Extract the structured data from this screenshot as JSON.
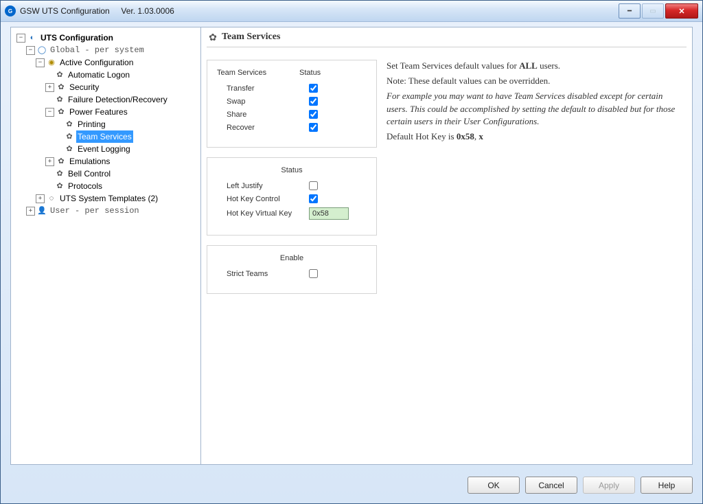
{
  "titlebar": {
    "app": "GSW UTS Configuration",
    "version": "Ver. 1.03.0006"
  },
  "tree": {
    "root": "UTS Configuration",
    "global": "Global  - per system",
    "active": "Active Configuration",
    "autolog": "Automatic Logon",
    "security": "Security",
    "failure": "Failure Detection/Recovery",
    "power": "Power Features",
    "printing": "Printing",
    "team": "Team Services",
    "eventlog": "Event Logging",
    "emulations": "Emulations",
    "bell": "Bell Control",
    "protocols": "Protocols",
    "templates": "UTS System Templates (2)",
    "user": "User   - per session"
  },
  "header": {
    "title": "Team Services"
  },
  "group1": {
    "h1": "Team Services",
    "h2": "Status",
    "transfer": "Transfer",
    "swap": "Swap",
    "share": "Share",
    "recover": "Recover"
  },
  "group2": {
    "h": "Status",
    "left_justify": "Left Justify",
    "hotkey_ctrl": "Hot Key Control",
    "hotkey_vk": "Hot Key Virtual Key",
    "hotkey_val": "0x58"
  },
  "group3": {
    "h": "Enable",
    "strict": "Strict Teams"
  },
  "checks": {
    "transfer": true,
    "swap": true,
    "share": true,
    "recover": true,
    "left_justify": false,
    "hotkey_ctrl": true,
    "strict": false
  },
  "desc": {
    "line1a": "Set Team Services default values for ",
    "line1b": "ALL",
    "line1c": " users.",
    "line2": "Note: These default values can be overridden.",
    "line3": "For example you may want to have Team Services disabled except for certain users. This could be accomplished by setting the default to disabled but for those certain users in their User Configurations.",
    "line4a": "Default Hot Key is ",
    "line4b": "0x58",
    "line4c": ", ",
    "line4d": "x"
  },
  "buttons": {
    "ok": "OK",
    "cancel": "Cancel",
    "apply": "Apply",
    "help": "Help"
  }
}
